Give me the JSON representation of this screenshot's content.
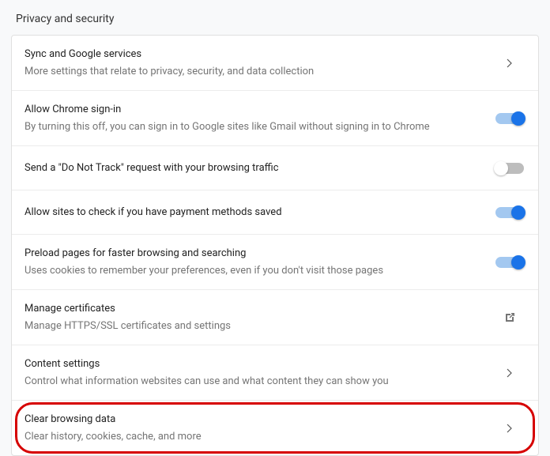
{
  "header": {
    "title": "Privacy and security"
  },
  "rows": [
    {
      "title": "Sync and Google services",
      "sub": "More settings that relate to privacy, security, and data collection"
    },
    {
      "title": "Allow Chrome sign-in",
      "sub": "By turning this off, you can sign in to Google sites like Gmail without signing in to Chrome"
    },
    {
      "title": "Send a \"Do Not Track\" request with your browsing traffic"
    },
    {
      "title": "Allow sites to check if you have payment methods saved"
    },
    {
      "title": "Preload pages for faster browsing and searching",
      "sub": "Uses cookies to remember your preferences, even if you don't visit those pages"
    },
    {
      "title": "Manage certificates",
      "sub": "Manage HTTPS/SSL certificates and settings"
    },
    {
      "title": "Content settings",
      "sub": "Control what information websites can use and what content they can show you"
    },
    {
      "title": "Clear browsing data",
      "sub": "Clear history, cookies, cache, and more"
    }
  ]
}
